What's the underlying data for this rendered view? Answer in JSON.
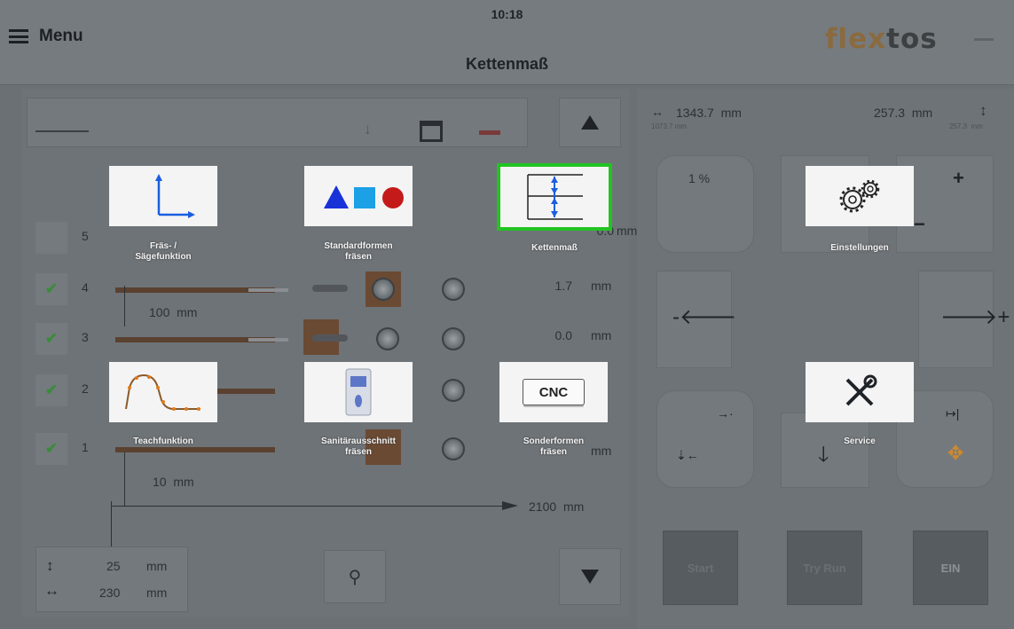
{
  "header": {
    "menu_label": "Menu",
    "clock": "10:18",
    "title": "Kettenmaß",
    "logo_part1": "flex",
    "logo_part2": "tos"
  },
  "toolbar": {
    "icons": [
      "arrow-icon",
      "save-icon",
      "minus-icon"
    ]
  },
  "rows": [
    {
      "num": "5",
      "value": "0.0",
      "unit": "mm",
      "checked": false
    },
    {
      "num": "4",
      "value": "1.7",
      "unit": "mm",
      "checked": true
    },
    {
      "num": "3",
      "value": "0.0",
      "unit": "mm",
      "checked": true
    },
    {
      "num": "2",
      "value": "",
      "unit": "",
      "checked": true
    },
    {
      "num": "1",
      "value": "",
      "unit": "mm",
      "checked": true
    }
  ],
  "dimensions": {
    "d100": "100",
    "d100_unit": "mm",
    "d10": "10",
    "d10_unit": "mm",
    "total": "2100",
    "total_unit": "mm"
  },
  "footer": {
    "height_value": "25",
    "height_unit": "mm",
    "width_value": "230",
    "width_unit": "mm"
  },
  "right_panel": {
    "x_value": "1343.7",
    "x_unit": "mm",
    "x_sub": "1073.7 mm",
    "y_value": "257.3",
    "y_unit": "mm",
    "y_sub": "257.3",
    "y_sub_unit": "mm",
    "percent": "1 %",
    "start_label": "Start",
    "tryrun_label": "Try Run",
    "ein_label": "EIN"
  },
  "menu_tiles": [
    {
      "label_line1": "Fräs- /",
      "label_line2": "Sägefunktion"
    },
    {
      "label_line1": "Standardformen",
      "label_line2": "fräsen"
    },
    {
      "label_line1": "Kettenmaß",
      "label_line2": ""
    },
    {
      "label_line1": "Einstellungen",
      "label_line2": ""
    },
    {
      "label_line1": "Teachfunktion",
      "label_line2": ""
    },
    {
      "label_line1": "Sanitärausschnitt",
      "label_line2": "fräsen"
    },
    {
      "label_line1": "Sonderformen",
      "label_line2": "fräsen"
    },
    {
      "label_line1": "Service",
      "label_line2": ""
    }
  ],
  "cnc_badge": "CNC",
  "colors": {
    "selected_border": "#22c322",
    "logo_accent": "#8a6a3e",
    "blue": "#1a5ee0",
    "red": "#c41a1a"
  }
}
